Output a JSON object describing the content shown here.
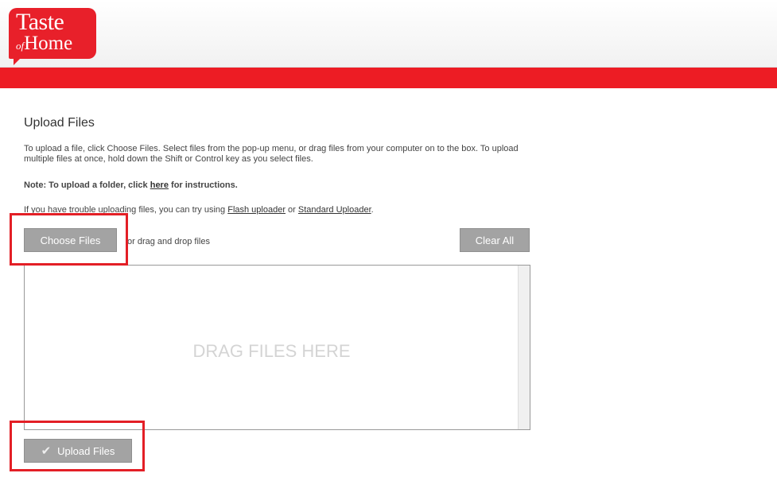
{
  "header": {
    "logo_line1": "Taste",
    "logo_of": "of",
    "logo_line2": "Home",
    "brand_color": "#ed1c24"
  },
  "main": {
    "title": "Upload Files",
    "instructions": "To upload a file, click Choose Files. Select files from the pop-up menu, or drag files from your computer on to the box. To upload multiple files at once, hold down the Shift or Control key as you select files.",
    "note_prefix": "Note: To upload a folder, click ",
    "note_link": "here",
    "note_suffix": " for instructions.",
    "trouble_prefix": "If you have trouble uploading files, you can try using ",
    "flash_link": "Flash uploader",
    "trouble_or": " or ",
    "standard_link": "Standard Uploader",
    "trouble_suffix": "."
  },
  "toolbar": {
    "choose_label": "Choose Files",
    "drag_drop_text": "or drag and drop files",
    "clear_label": "Clear All"
  },
  "dropzone": {
    "text": "DRAG FILES HERE"
  },
  "footer": {
    "upload_label": "Upload Files",
    "upload_icon": "checkmark-icon"
  },
  "highlight_color": "#e31f26"
}
